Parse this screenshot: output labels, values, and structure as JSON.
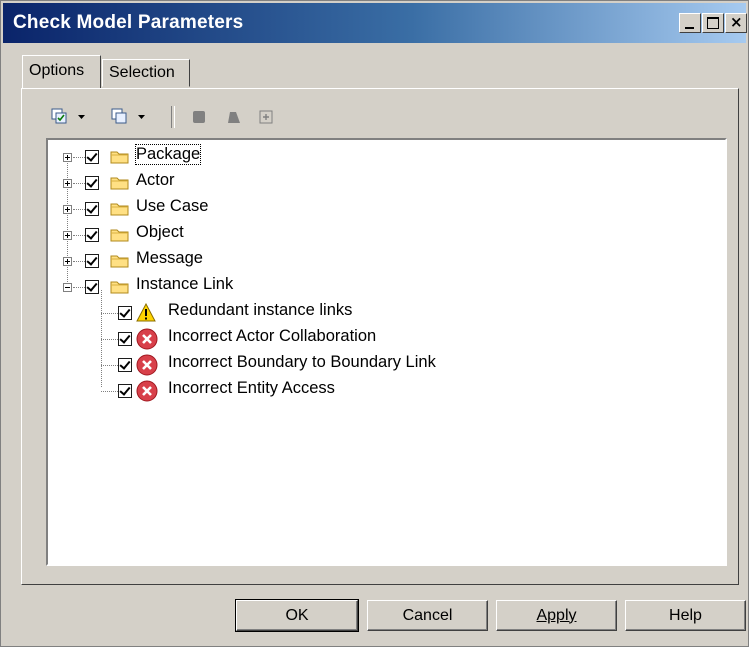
{
  "window": {
    "title": "Check Model Parameters",
    "minimize_glyph": "_",
    "close_glyph": "×"
  },
  "tabs": [
    {
      "label": "Options",
      "selected": true
    },
    {
      "label": "Selection",
      "selected": false
    }
  ],
  "toolbar": {
    "icons": [
      "select-all-icon",
      "dropdown-arrow-icon",
      "deselect-all-icon",
      "dropdown-arrow-icon",
      "square-icon",
      "shape-icon",
      "expand-icon"
    ]
  },
  "tree": {
    "items": [
      {
        "label": "Package",
        "checked": true,
        "expanded": false,
        "icon": "folder-icon"
      },
      {
        "label": "Actor",
        "checked": true,
        "expanded": false,
        "icon": "folder-icon"
      },
      {
        "label": "Use Case",
        "checked": true,
        "expanded": false,
        "icon": "folder-icon"
      },
      {
        "label": "Object",
        "checked": true,
        "expanded": false,
        "icon": "folder-icon"
      },
      {
        "label": "Message",
        "checked": true,
        "expanded": false,
        "icon": "folder-icon"
      },
      {
        "label": "Instance Link",
        "checked": true,
        "expanded": true,
        "icon": "folder-icon",
        "children": [
          {
            "label": "Redundant instance links",
            "checked": true,
            "icon": "warning-icon"
          },
          {
            "label": "Incorrect Actor Collaboration",
            "checked": true,
            "icon": "error-icon"
          },
          {
            "label": "Incorrect Boundary to Boundary Link",
            "checked": true,
            "icon": "error-icon"
          },
          {
            "label": "Incorrect Entity Access",
            "checked": true,
            "icon": "error-icon"
          }
        ]
      }
    ]
  },
  "buttons": {
    "ok": "OK",
    "cancel": "Cancel",
    "apply": "Apply",
    "help": "Help"
  }
}
